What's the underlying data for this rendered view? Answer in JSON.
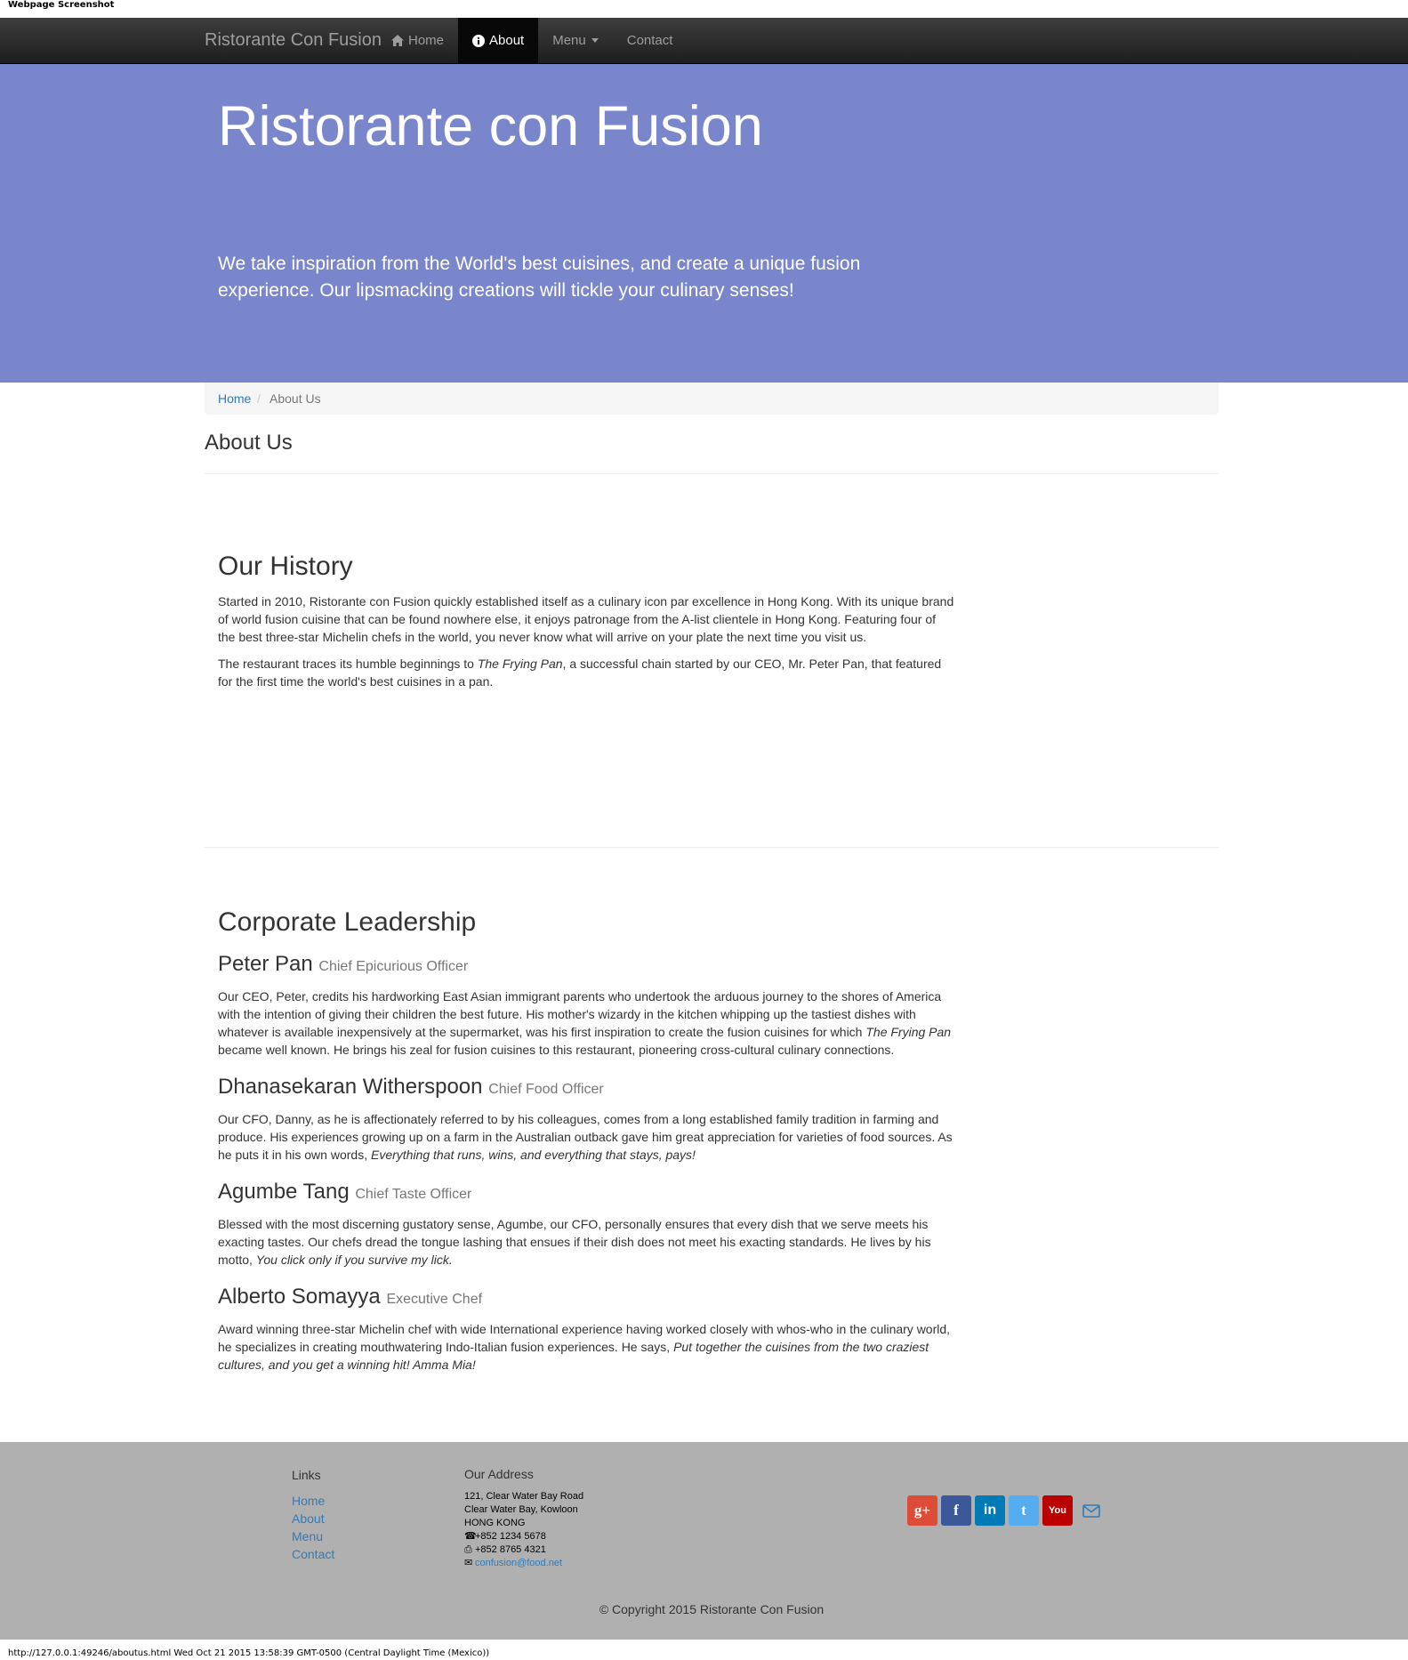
{
  "capture": {
    "label": "Webpage Screenshot",
    "footer": "http://127.0.0.1:49246/aboutus.html Wed Oct 21 2015 13:58:39 GMT-0500 (Central Daylight Time (Mexico))"
  },
  "navbar": {
    "brand": "Ristorante Con Fusion",
    "items": [
      {
        "label": "Home",
        "icon": "home-icon",
        "active": false
      },
      {
        "label": "About",
        "icon": "info-icon",
        "active": true
      },
      {
        "label": "Menu",
        "icon": "caret-down-icon",
        "active": false
      },
      {
        "label": "Contact",
        "active": false
      }
    ]
  },
  "jumbotron": {
    "title": "Ristorante con Fusion",
    "text": "We take inspiration from the World's best cuisines, and create a unique fusion experience. Our lipsmacking creations will tickle your culinary senses!"
  },
  "breadcrumb": {
    "home": "Home",
    "separator": "/",
    "current": "About Us"
  },
  "page_title": "About Us",
  "history": {
    "title": "Our History",
    "paragraph1": "Started in 2010, Ristorante con Fusion quickly established itself as a culinary icon par excellence in Hong Kong. With its unique brand of world fusion cuisine that can be found nowhere else, it enjoys patronage from the A-list clientele in Hong Kong. Featuring four of the best three-star Michelin chefs in the world, you never know what will arrive on your plate the next time you visit us.",
    "paragraph2_before": "The restaurant traces its humble beginnings to ",
    "paragraph2_italic": "The Frying Pan",
    "paragraph2_after": ", a successful chain started by our CEO, Mr. Peter Pan, that featured for the first time the world's best cuisines in a pan."
  },
  "leadership": {
    "title": "Corporate Leadership",
    "leaders": [
      {
        "name": "Peter Pan",
        "role": "Chief Epicurious Officer",
        "text_before": "Our CEO, Peter, credits his hardworking East Asian immigrant parents who undertook the arduous journey to the shores of America with the intention of giving their children the best future. His mother's wizardy in the kitchen whipping up the tastiest dishes with whatever is available inexpensively at the supermarket, was his first inspiration to create the fusion cuisines for which ",
        "text_italic": "The Frying Pan",
        "text_after": " became well known. He brings his zeal for fusion cuisines to this restaurant, pioneering cross-cultural culinary connections."
      },
      {
        "name": "Dhanasekaran Witherspoon",
        "role": "Chief Food Officer",
        "text_before": "Our CFO, Danny, as he is affectionately referred to by his colleagues, comes from a long established family tradition in farming and produce. His experiences growing up on a farm in the Australian outback gave him great appreciation for varieties of food sources. As he puts it in his own words, ",
        "text_italic": "Everything that runs, wins, and everything that stays, pays!",
        "text_after": ""
      },
      {
        "name": "Agumbe Tang",
        "role": "Chief Taste Officer",
        "text_before": "Blessed with the most discerning gustatory sense, Agumbe, our CFO, personally ensures that every dish that we serve meets his exacting tastes. Our chefs dread the tongue lashing that ensues if their dish does not meet his exacting standards. He lives by his motto, ",
        "text_italic": "You click only if you survive my lick.",
        "text_after": ""
      },
      {
        "name": "Alberto Somayya",
        "role": "Executive Chef",
        "text_before": "Award winning three-star Michelin chef with wide International experience having worked closely with whos-who in the culinary world, he specializes in creating mouthwatering Indo-Italian fusion experiences. He says, ",
        "text_italic": "Put together the cuisines from the two craziest cultures, and you get a winning hit! Amma Mia!",
        "text_after": ""
      }
    ]
  },
  "footer": {
    "links_title": "Links",
    "links": [
      "Home",
      "About",
      "Menu",
      "Contact"
    ],
    "address_title": "Our Address",
    "address_lines": [
      "121, Clear Water Bay Road",
      "Clear Water Bay, Kowloon",
      "HONG KONG"
    ],
    "phone": "+852 1234 5678",
    "fax": "+852 8765 4321",
    "email": "confusion@food.net",
    "social": [
      {
        "name": "google-plus-icon",
        "glyph": "g+",
        "color": "#dd4b39"
      },
      {
        "name": "facebook-icon",
        "glyph": "f",
        "color": "#3b5998"
      },
      {
        "name": "linkedin-icon",
        "glyph": "in",
        "color": "#007bb6"
      },
      {
        "name": "twitter-icon",
        "glyph": "t",
        "color": "#55acee"
      },
      {
        "name": "youtube-icon",
        "glyph": "You",
        "color": "#bb0000"
      }
    ],
    "copyright": "© Copyright 2015 Ristorante Con Fusion"
  },
  "colors": {
    "navbar": "#222222",
    "jumbotron": "#7986cb",
    "footer": "#b0b0b0",
    "link": "#337ab7"
  }
}
